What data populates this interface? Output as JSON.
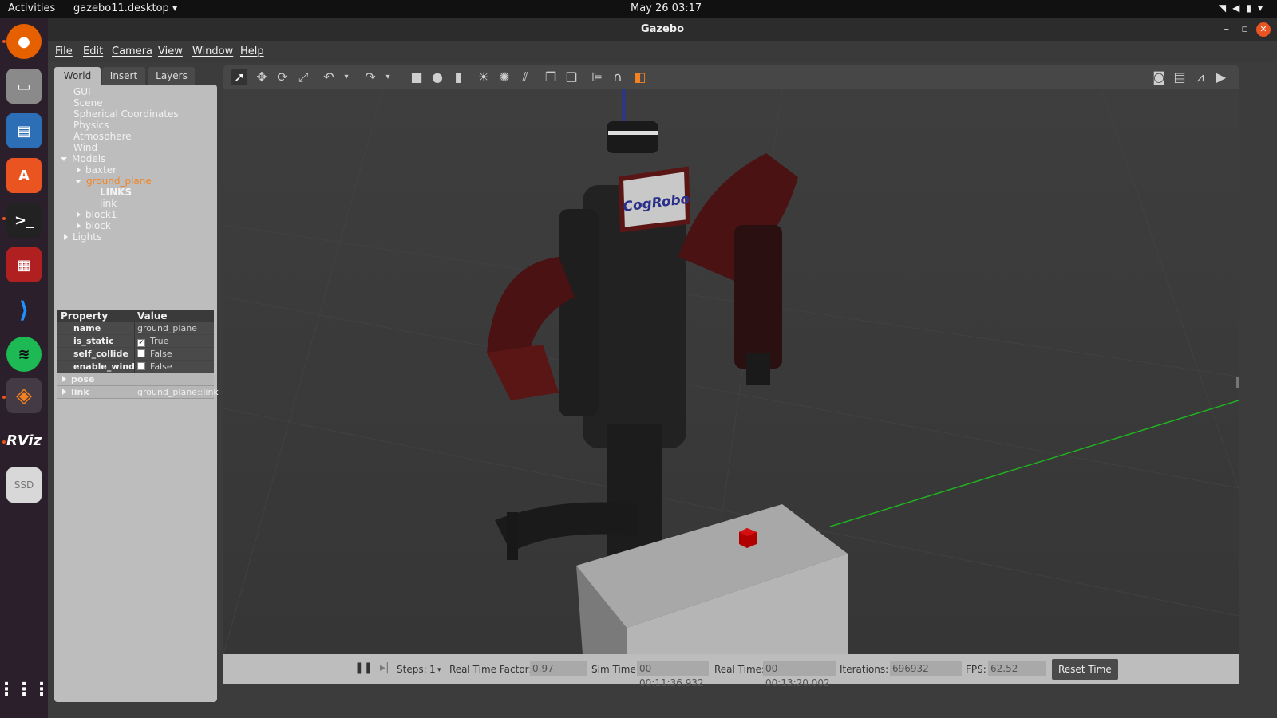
{
  "topbar": {
    "activities": "Activities",
    "app_name": "gazebo11.desktop ▾",
    "clock": "May 26  03:17"
  },
  "window": {
    "title": "Gazebo"
  },
  "menu": [
    "File",
    "Edit",
    "Camera",
    "View",
    "Window",
    "Help"
  ],
  "left_panel": {
    "tabs": [
      "World",
      "Insert",
      "Layers"
    ],
    "tree": {
      "gui": "GUI",
      "scene": "Scene",
      "spherical": "Spherical Coordinates",
      "physics": "Physics",
      "atmosphere": "Atmosphere",
      "wind": "Wind",
      "models": "Models",
      "baxter": "baxter",
      "ground_plane": "ground_plane",
      "links": "LINKS",
      "link": "link",
      "block1": "block1",
      "block": "block",
      "lights": "Lights"
    },
    "properties": {
      "header_property": "Property",
      "header_value": "Value",
      "rows": [
        {
          "key": "name",
          "value": "ground_plane"
        },
        {
          "key": "is_static",
          "value": "True"
        },
        {
          "key": "self_collide",
          "value": "False"
        },
        {
          "key": "enable_wind",
          "value": "False"
        },
        {
          "key": "pose",
          "value": ""
        },
        {
          "key": "link",
          "value": "ground_plane::link"
        }
      ]
    }
  },
  "viewport": {
    "logo_text": "CogRobo"
  },
  "bottom": {
    "steps_label": "Steps:",
    "steps_value": "1",
    "rtf_label": "Real Time Factor:",
    "rtf_value": "0.97",
    "sim_time_label": "Sim Time:",
    "sim_time_value": "00 00:11:36.932",
    "real_time_label": "Real Time:",
    "real_time_value": "00 00:13:20.002",
    "iterations_label": "Iterations:",
    "iterations_value": "696932",
    "fps_label": "FPS:",
    "fps_value": "62.52",
    "reset_label": "Reset Time"
  },
  "dock": {
    "ssd_label": "SSD",
    "rviz_label": "RViz"
  }
}
